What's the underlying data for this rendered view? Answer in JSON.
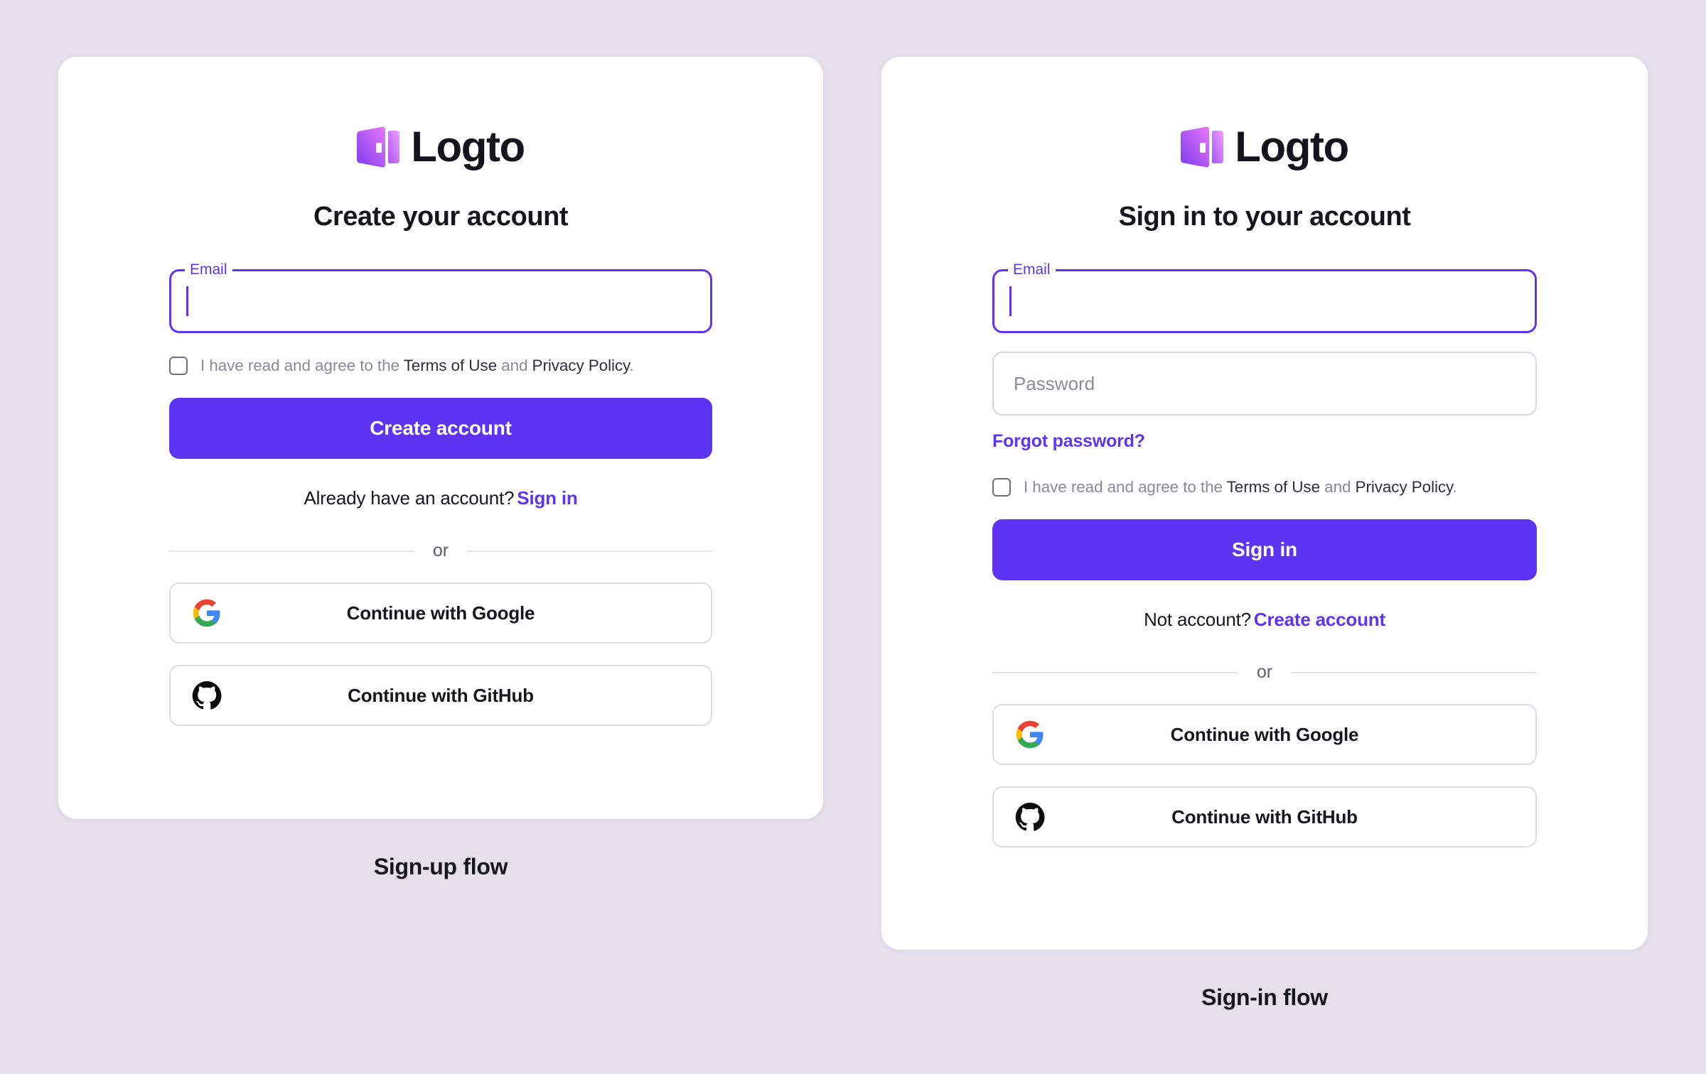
{
  "background_color": "#e4e1ec",
  "brand": {
    "name": "Logto",
    "accent_color": "#5d34f2",
    "logo_icon": "logto-door-logo",
    "logo_gradient_from": "#7c3aed",
    "logo_gradient_to": "#e879f9"
  },
  "signup": {
    "caption": "Sign-up flow",
    "heading": "Create your account",
    "email": {
      "label": "Email",
      "value": "",
      "placeholder": "",
      "focused": true
    },
    "agreement": {
      "checked": false,
      "prefix": "I have read and agree to the ",
      "terms_link": "Terms of Use",
      "conjunction": " and ",
      "privacy_link": "Privacy Policy",
      "suffix": "."
    },
    "primary_button": "Create account",
    "switch": {
      "prompt": "Already have an account?",
      "action": "Sign in"
    },
    "divider_label": "or",
    "social": [
      {
        "icon": "google-icon",
        "label": "Continue with Google"
      },
      {
        "icon": "github-icon",
        "label": "Continue with GitHub"
      }
    ]
  },
  "signin": {
    "caption": "Sign-in flow",
    "heading": "Sign in to your account",
    "email": {
      "label": "Email",
      "value": "",
      "placeholder": "",
      "focused": true
    },
    "password": {
      "value": "",
      "placeholder": "Password"
    },
    "forgot_password": "Forgot password?",
    "agreement": {
      "checked": false,
      "prefix": "I have read and agree to the ",
      "terms_link": "Terms of Use",
      "conjunction": " and ",
      "privacy_link": "Privacy Policy",
      "suffix": "."
    },
    "primary_button": "Sign in",
    "switch": {
      "prompt": "Not account?",
      "action": "Create account"
    },
    "divider_label": "or",
    "social": [
      {
        "icon": "google-icon",
        "label": "Continue with Google"
      },
      {
        "icon": "github-icon",
        "label": "Continue with GitHub"
      }
    ]
  }
}
